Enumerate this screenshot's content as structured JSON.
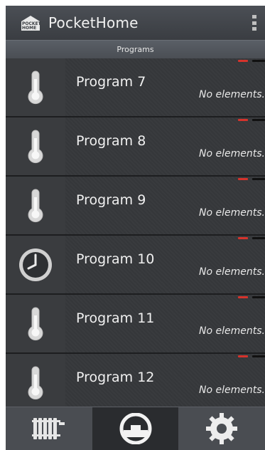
{
  "app": {
    "title": "PocketHome",
    "logo_text_top": "POCKET",
    "logo_text_bottom": "HOME"
  },
  "section": {
    "label": "Programs"
  },
  "programs": [
    {
      "name": "Program  7",
      "status": "No elements.",
      "icon": "thermometer-icon"
    },
    {
      "name": "Program  8",
      "status": "No elements.",
      "icon": "thermometer-icon"
    },
    {
      "name": "Program  9",
      "status": "No elements.",
      "icon": "thermometer-icon"
    },
    {
      "name": "Program 10",
      "status": "No elements.",
      "icon": "clock-icon"
    },
    {
      "name": "Program 11",
      "status": "No elements.",
      "icon": "thermometer-icon"
    },
    {
      "name": "Program 12",
      "status": "No elements.",
      "icon": "thermometer-icon"
    }
  ],
  "bottom_tabs": [
    {
      "icon": "radiator-icon",
      "active": false
    },
    {
      "icon": "gauge-icon",
      "active": true
    },
    {
      "icon": "gear-icon",
      "active": false
    }
  ],
  "colors": {
    "led_red": "#d5332c",
    "background": "#2b2d30"
  }
}
